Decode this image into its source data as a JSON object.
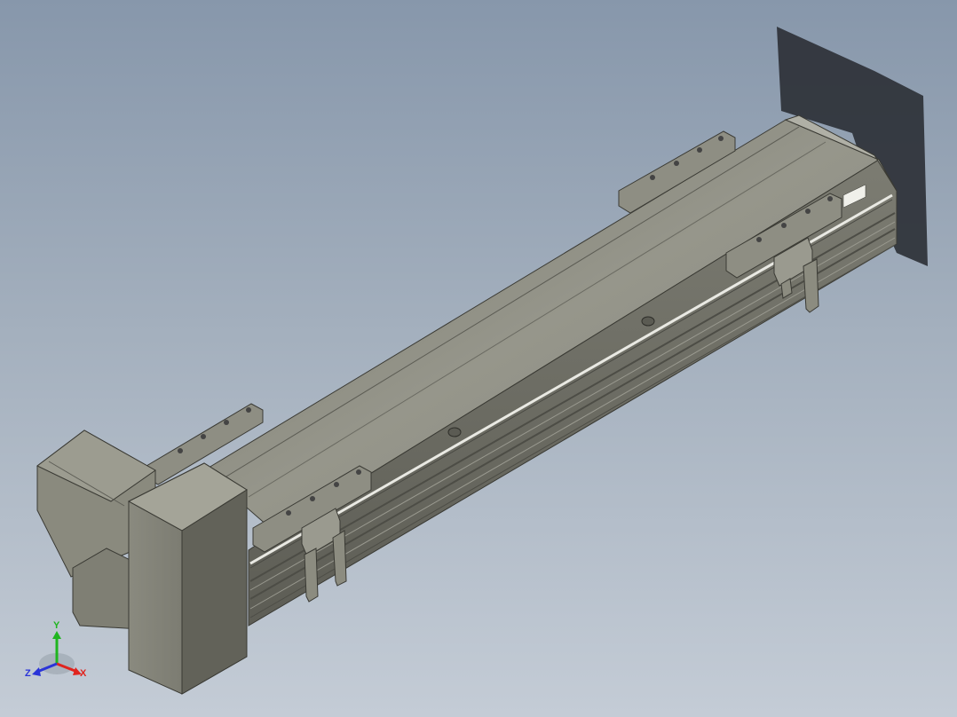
{
  "viewport": {
    "background_top": "#8797ab",
    "background_bottom": "#c4ccd6"
  },
  "model": {
    "description_icon": "linear-actuator-3d-model",
    "body_color": "#8c8c80",
    "body_dark": "#6e6e64",
    "shadow_color": "#2b2f35"
  },
  "triad": {
    "x_label": "X",
    "y_label": "Y",
    "z_label": "Z",
    "x_color": "#e0241e",
    "y_color": "#1fb51f",
    "z_color": "#2a34d8"
  }
}
